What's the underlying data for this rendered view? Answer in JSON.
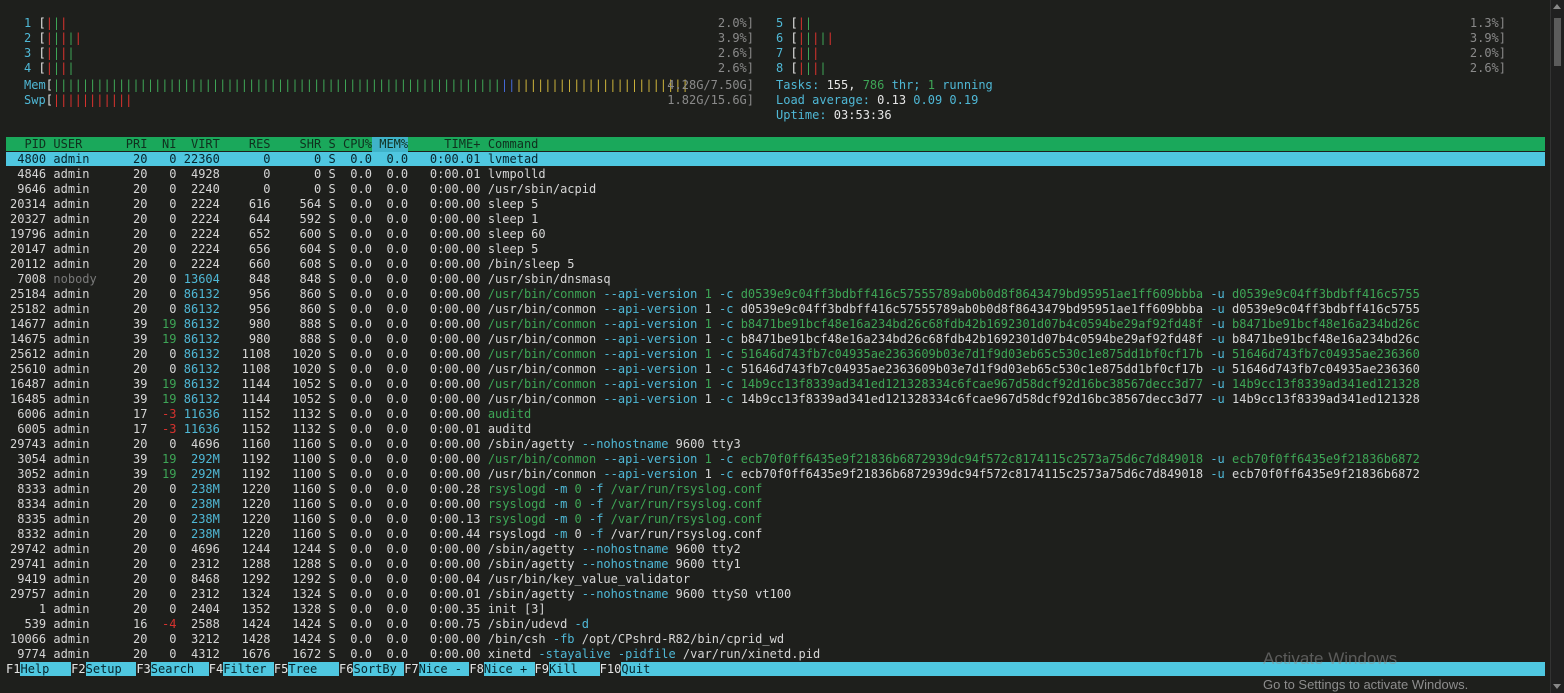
{
  "cpu_meters": [
    {
      "id": "1",
      "bars": "|||",
      "value": "2.0%]"
    },
    {
      "id": "2",
      "bars": "|||||",
      "value": "3.9%]"
    },
    {
      "id": "3",
      "bars": "||||",
      "value": "2.6%]"
    },
    {
      "id": "4",
      "bars": "||||",
      "value": "2.6%]"
    },
    {
      "id": "5",
      "bars": "||",
      "value": "1.3%]"
    },
    {
      "id": "6",
      "bars": "|||||",
      "value": "3.9%]"
    },
    {
      "id": "7",
      "bars": "|||",
      "value": "2.0%]"
    },
    {
      "id": "8",
      "bars": "||||",
      "value": "2.6%]"
    }
  ],
  "mem": {
    "label": "Mem",
    "value": "4.28G/7.50G]"
  },
  "swap": {
    "label": "Swp",
    "value": "1.82G/15.6G]"
  },
  "tasks": {
    "label": "Tasks:",
    "count": "155,",
    "thr": "786",
    "thr_label": "thr;",
    "running": "1",
    "running_label": "running"
  },
  "load": {
    "label": "Load average:",
    "v1": "0.13",
    "v2": "0.09",
    "v3": "0.19"
  },
  "uptime": {
    "label": "Uptime:",
    "value": "03:53:36"
  },
  "columns": [
    "PID",
    "USER",
    "PRI",
    "NI",
    "VIRT",
    "RES",
    "SHR",
    "S",
    "CPU%",
    "MEM%",
    "TIME+",
    "Command"
  ],
  "processes": [
    {
      "pid": "4800",
      "user": "admin",
      "pri": "20",
      "ni": "0",
      "virt": "22360",
      "res": "0",
      "shr": "0",
      "s": "S",
      "cpu": "0.0",
      "mem": "0.0",
      "time": "0:00.01",
      "cmd": "lvmetad",
      "thread": false
    },
    {
      "pid": "4846",
      "user": "admin",
      "pri": "20",
      "ni": "0",
      "virt": "4928",
      "res": "0",
      "shr": "0",
      "s": "S",
      "cpu": "0.0",
      "mem": "0.0",
      "time": "0:00.01",
      "cmd": "lvmpolld",
      "thread": false
    },
    {
      "pid": "9646",
      "user": "admin",
      "pri": "20",
      "ni": "0",
      "virt": "2240",
      "res": "0",
      "shr": "0",
      "s": "S",
      "cpu": "0.0",
      "mem": "0.0",
      "time": "0:00.00",
      "cmd": "/usr/sbin/acpid",
      "thread": false
    },
    {
      "pid": "20314",
      "user": "admin",
      "pri": "20",
      "ni": "0",
      "virt": "2224",
      "res": "616",
      "shr": "564",
      "s": "S",
      "cpu": "0.0",
      "mem": "0.0",
      "time": "0:00.00",
      "cmd": "sleep 5",
      "thread": false
    },
    {
      "pid": "20327",
      "user": "admin",
      "pri": "20",
      "ni": "0",
      "virt": "2224",
      "res": "644",
      "shr": "592",
      "s": "S",
      "cpu": "0.0",
      "mem": "0.0",
      "time": "0:00.00",
      "cmd": "sleep 1",
      "thread": false
    },
    {
      "pid": "19796",
      "user": "admin",
      "pri": "20",
      "ni": "0",
      "virt": "2224",
      "res": "652",
      "shr": "600",
      "s": "S",
      "cpu": "0.0",
      "mem": "0.0",
      "time": "0:00.00",
      "cmd": "sleep 60",
      "thread": false
    },
    {
      "pid": "20147",
      "user": "admin",
      "pri": "20",
      "ni": "0",
      "virt": "2224",
      "res": "656",
      "shr": "604",
      "s": "S",
      "cpu": "0.0",
      "mem": "0.0",
      "time": "0:00.00",
      "cmd": "sleep 5",
      "thread": false
    },
    {
      "pid": "20112",
      "user": "admin",
      "pri": "20",
      "ni": "0",
      "virt": "2224",
      "res": "660",
      "shr": "608",
      "s": "S",
      "cpu": "0.0",
      "mem": "0.0",
      "time": "0:00.00",
      "cmd": "/bin/sleep 5",
      "thread": false
    },
    {
      "pid": "7008",
      "user": "nobody",
      "pri": "20",
      "ni": "0",
      "virt": "13604",
      "res": "848",
      "shr": "848",
      "s": "S",
      "cpu": "0.0",
      "mem": "0.0",
      "time": "0:00.00",
      "cmd": "/usr/sbin/dnsmasq",
      "thread": false
    },
    {
      "pid": "25184",
      "user": "admin",
      "pri": "20",
      "ni": "0",
      "virt": "86132",
      "res": "956",
      "shr": "860",
      "s": "S",
      "cpu": "0.0",
      "mem": "0.0",
      "time": "0:00.00",
      "cmd": "/usr/bin/conmon --api-version 1 -c d0539e9c04ff3bdbff416c57555789ab0b0d8f8643479bd95951ae1ff609bbba -u d0539e9c04ff3bdbff416c5755",
      "thread": true
    },
    {
      "pid": "25182",
      "user": "admin",
      "pri": "20",
      "ni": "0",
      "virt": "86132",
      "res": "956",
      "shr": "860",
      "s": "S",
      "cpu": "0.0",
      "mem": "0.0",
      "time": "0:00.00",
      "cmd": "/usr/bin/conmon --api-version 1 -c d0539e9c04ff3bdbff416c57555789ab0b0d8f8643479bd95951ae1ff609bbba -u d0539e9c04ff3bdbff416c5755",
      "thread": false
    },
    {
      "pid": "14677",
      "user": "admin",
      "pri": "39",
      "ni": "19",
      "virt": "86132",
      "res": "980",
      "shr": "888",
      "s": "S",
      "cpu": "0.0",
      "mem": "0.0",
      "time": "0:00.00",
      "cmd": "/usr/bin/conmon --api-version 1 -c b8471be91bcf48e16a234bd26c68fdb42b1692301d07b4c0594be29af92fd48f -u b8471be91bcf48e16a234bd26c",
      "thread": true
    },
    {
      "pid": "14675",
      "user": "admin",
      "pri": "39",
      "ni": "19",
      "virt": "86132",
      "res": "980",
      "shr": "888",
      "s": "S",
      "cpu": "0.0",
      "mem": "0.0",
      "time": "0:00.00",
      "cmd": "/usr/bin/conmon --api-version 1 -c b8471be91bcf48e16a234bd26c68fdb42b1692301d07b4c0594be29af92fd48f -u b8471be91bcf48e16a234bd26c",
      "thread": false
    },
    {
      "pid": "25612",
      "user": "admin",
      "pri": "20",
      "ni": "0",
      "virt": "86132",
      "res": "1108",
      "shr": "1020",
      "s": "S",
      "cpu": "0.0",
      "mem": "0.0",
      "time": "0:00.00",
      "cmd": "/usr/bin/conmon --api-version 1 -c 51646d743fb7c04935ae2363609b03e7d1f9d03eb65c530c1e875dd1bf0cf17b -u 51646d743fb7c04935ae236360",
      "thread": true
    },
    {
      "pid": "25610",
      "user": "admin",
      "pri": "20",
      "ni": "0",
      "virt": "86132",
      "res": "1108",
      "shr": "1020",
      "s": "S",
      "cpu": "0.0",
      "mem": "0.0",
      "time": "0:00.00",
      "cmd": "/usr/bin/conmon --api-version 1 -c 51646d743fb7c04935ae2363609b03e7d1f9d03eb65c530c1e875dd1bf0cf17b -u 51646d743fb7c04935ae236360",
      "thread": false
    },
    {
      "pid": "16487",
      "user": "admin",
      "pri": "39",
      "ni": "19",
      "virt": "86132",
      "res": "1144",
      "shr": "1052",
      "s": "S",
      "cpu": "0.0",
      "mem": "0.0",
      "time": "0:00.00",
      "cmd": "/usr/bin/conmon --api-version 1 -c 14b9cc13f8339ad341ed121328334c6fcae967d58dcf92d16bc38567decc3d77 -u 14b9cc13f8339ad341ed121328",
      "thread": true
    },
    {
      "pid": "16485",
      "user": "admin",
      "pri": "39",
      "ni": "19",
      "virt": "86132",
      "res": "1144",
      "shr": "1052",
      "s": "S",
      "cpu": "0.0",
      "mem": "0.0",
      "time": "0:00.00",
      "cmd": "/usr/bin/conmon --api-version 1 -c 14b9cc13f8339ad341ed121328334c6fcae967d58dcf92d16bc38567decc3d77 -u 14b9cc13f8339ad341ed121328",
      "thread": false
    },
    {
      "pid": "6006",
      "user": "admin",
      "pri": "17",
      "ni": "-3",
      "virt": "11636",
      "res": "1152",
      "shr": "1132",
      "s": "S",
      "cpu": "0.0",
      "mem": "0.0",
      "time": "0:00.00",
      "cmd": "auditd",
      "thread": true
    },
    {
      "pid": "6005",
      "user": "admin",
      "pri": "17",
      "ni": "-3",
      "virt": "11636",
      "res": "1152",
      "shr": "1132",
      "s": "S",
      "cpu": "0.0",
      "mem": "0.0",
      "time": "0:00.01",
      "cmd": "auditd",
      "thread": false
    },
    {
      "pid": "29743",
      "user": "admin",
      "pri": "20",
      "ni": "0",
      "virt": "4696",
      "res": "1160",
      "shr": "1160",
      "s": "S",
      "cpu": "0.0",
      "mem": "0.0",
      "time": "0:00.00",
      "cmd": "/sbin/agetty --nohostname 9600 tty3",
      "thread": false
    },
    {
      "pid": "3054",
      "user": "admin",
      "pri": "39",
      "ni": "19",
      "virt": "292M",
      "res": "1192",
      "shr": "1100",
      "s": "S",
      "cpu": "0.0",
      "mem": "0.0",
      "time": "0:00.00",
      "cmd": "/usr/bin/conmon --api-version 1 -c ecb70f0ff6435e9f21836b6872939dc94f572c8174115c2573a75d6c7d849018 -u ecb70f0ff6435e9f21836b6872",
      "thread": true
    },
    {
      "pid": "3052",
      "user": "admin",
      "pri": "39",
      "ni": "19",
      "virt": "292M",
      "res": "1192",
      "shr": "1100",
      "s": "S",
      "cpu": "0.0",
      "mem": "0.0",
      "time": "0:00.00",
      "cmd": "/usr/bin/conmon --api-version 1 -c ecb70f0ff6435e9f21836b6872939dc94f572c8174115c2573a75d6c7d849018 -u ecb70f0ff6435e9f21836b6872",
      "thread": false
    },
    {
      "pid": "8333",
      "user": "admin",
      "pri": "20",
      "ni": "0",
      "virt": "238M",
      "res": "1220",
      "shr": "1160",
      "s": "S",
      "cpu": "0.0",
      "mem": "0.0",
      "time": "0:00.28",
      "cmd": "rsyslogd -m 0 -f /var/run/rsyslog.conf",
      "thread": true
    },
    {
      "pid": "8334",
      "user": "admin",
      "pri": "20",
      "ni": "0",
      "virt": "238M",
      "res": "1220",
      "shr": "1160",
      "s": "S",
      "cpu": "0.0",
      "mem": "0.0",
      "time": "0:00.00",
      "cmd": "rsyslogd -m 0 -f /var/run/rsyslog.conf",
      "thread": true
    },
    {
      "pid": "8335",
      "user": "admin",
      "pri": "20",
      "ni": "0",
      "virt": "238M",
      "res": "1220",
      "shr": "1160",
      "s": "S",
      "cpu": "0.0",
      "mem": "0.0",
      "time": "0:00.13",
      "cmd": "rsyslogd -m 0 -f /var/run/rsyslog.conf",
      "thread": true
    },
    {
      "pid": "8332",
      "user": "admin",
      "pri": "20",
      "ni": "0",
      "virt": "238M",
      "res": "1220",
      "shr": "1160",
      "s": "S",
      "cpu": "0.0",
      "mem": "0.0",
      "time": "0:00.44",
      "cmd": "rsyslogd -m 0 -f /var/run/rsyslog.conf",
      "thread": false
    },
    {
      "pid": "29742",
      "user": "admin",
      "pri": "20",
      "ni": "0",
      "virt": "4696",
      "res": "1244",
      "shr": "1244",
      "s": "S",
      "cpu": "0.0",
      "mem": "0.0",
      "time": "0:00.00",
      "cmd": "/sbin/agetty --nohostname 9600 tty2",
      "thread": false
    },
    {
      "pid": "29741",
      "user": "admin",
      "pri": "20",
      "ni": "0",
      "virt": "2312",
      "res": "1288",
      "shr": "1288",
      "s": "S",
      "cpu": "0.0",
      "mem": "0.0",
      "time": "0:00.00",
      "cmd": "/sbin/agetty --nohostname 9600 tty1",
      "thread": false
    },
    {
      "pid": "9419",
      "user": "admin",
      "pri": "20",
      "ni": "0",
      "virt": "8468",
      "res": "1292",
      "shr": "1292",
      "s": "S",
      "cpu": "0.0",
      "mem": "0.0",
      "time": "0:00.04",
      "cmd": "/usr/bin/key_value_validator",
      "thread": false
    },
    {
      "pid": "29757",
      "user": "admin",
      "pri": "20",
      "ni": "0",
      "virt": "2312",
      "res": "1324",
      "shr": "1324",
      "s": "S",
      "cpu": "0.0",
      "mem": "0.0",
      "time": "0:00.01",
      "cmd": "/sbin/agetty --nohostname 9600 ttyS0 vt100",
      "thread": false
    },
    {
      "pid": "1",
      "user": "admin",
      "pri": "20",
      "ni": "0",
      "virt": "2404",
      "res": "1352",
      "shr": "1328",
      "s": "S",
      "cpu": "0.0",
      "mem": "0.0",
      "time": "0:00.35",
      "cmd": "init [3]",
      "thread": false
    },
    {
      "pid": "539",
      "user": "admin",
      "pri": "16",
      "ni": "-4",
      "virt": "2588",
      "res": "1424",
      "shr": "1424",
      "s": "S",
      "cpu": "0.0",
      "mem": "0.0",
      "time": "0:00.75",
      "cmd": "/sbin/udevd -d",
      "thread": false
    },
    {
      "pid": "10066",
      "user": "admin",
      "pri": "20",
      "ni": "0",
      "virt": "3212",
      "res": "1428",
      "shr": "1424",
      "s": "S",
      "cpu": "0.0",
      "mem": "0.0",
      "time": "0:00.00",
      "cmd": "/bin/csh -fb /opt/CPshrd-R82/bin/cprid_wd",
      "thread": false
    },
    {
      "pid": "9774",
      "user": "admin",
      "pri": "20",
      "ni": "0",
      "virt": "4312",
      "res": "1676",
      "shr": "1672",
      "s": "S",
      "cpu": "0.0",
      "mem": "0.0",
      "time": "0:00.00",
      "cmd": "xinetd -stayalive -pidfile /var/run/xinetd.pid",
      "thread": false
    }
  ],
  "function_keys": [
    {
      "key": "F1",
      "label": "Help"
    },
    {
      "key": "F2",
      "label": "Setup"
    },
    {
      "key": "F3",
      "label": "Search"
    },
    {
      "key": "F4",
      "label": "Filter"
    },
    {
      "key": "F5",
      "label": "Tree"
    },
    {
      "key": "F6",
      "label": "SortBy"
    },
    {
      "key": "F7",
      "label": "Nice -"
    },
    {
      "key": "F8",
      "label": "Nice +"
    },
    {
      "key": "F9",
      "label": "Kill"
    },
    {
      "key": "F10",
      "label": "Quit"
    }
  ],
  "watermark": {
    "title": "Activate Windows",
    "subtitle": "Go to Settings to activate Windows."
  },
  "colors": {
    "background": "#1e1f1c",
    "header": "#1aa85b",
    "selection": "#4fc7e0",
    "thread_text": "#3ea556"
  }
}
